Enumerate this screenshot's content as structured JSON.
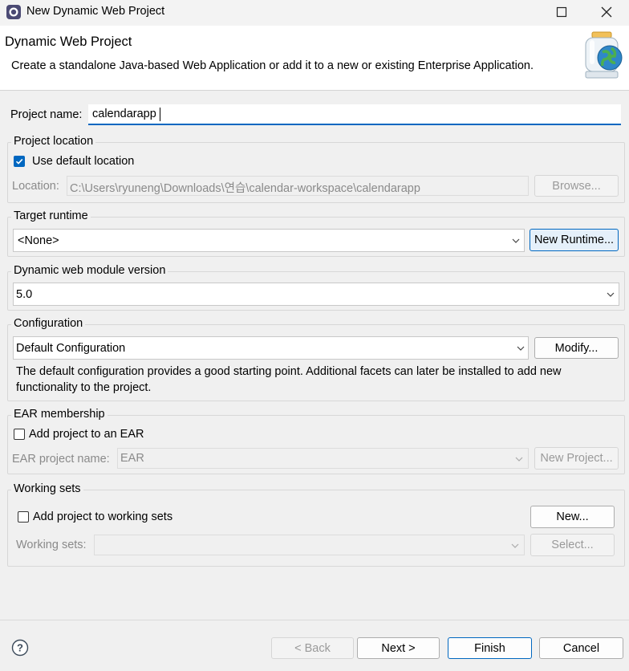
{
  "window": {
    "title": "New Dynamic Web Project",
    "icons": {
      "app": "eclipse-icon",
      "maximize": "maximize-icon",
      "close": "close-icon"
    }
  },
  "banner": {
    "title": "Dynamic Web Project",
    "description": "Create a standalone Java-based Web Application or add it to a new or existing Enterprise Application.",
    "image": "web-globe-jar-icon"
  },
  "project_name": {
    "label": "Project name:",
    "value": "calendarapp"
  },
  "project_location": {
    "group_label": "Project location",
    "use_default_label": "Use default location",
    "use_default_checked": true,
    "location_label": "Location:",
    "location_value": "C:\\Users\\ryuneng\\Downloads\\연습\\calendar-workspace\\calendarapp",
    "browse_label": "Browse..."
  },
  "target_runtime": {
    "group_label": "Target runtime",
    "selected": "<None>",
    "new_runtime_label": "New Runtime..."
  },
  "web_module": {
    "group_label": "Dynamic web module version",
    "selected": "5.0"
  },
  "configuration": {
    "group_label": "Configuration",
    "selected": "Default Configuration",
    "modify_label": "Modify...",
    "description_line1": "The default configuration provides a good starting point. Additional facets can later be installed to add new",
    "description_line2": "functionality to the project."
  },
  "ear": {
    "group_label": "EAR membership",
    "add_label": "Add project to an EAR",
    "add_checked": false,
    "name_label": "EAR project name:",
    "name_value": "EAR",
    "new_project_label": "New Project..."
  },
  "working_sets": {
    "group_label": "Working sets",
    "add_label": "Add project to working sets",
    "add_checked": false,
    "new_label": "New...",
    "sets_label": "Working sets:",
    "select_label": "Select..."
  },
  "footer": {
    "help_icon": "help-icon",
    "back_label": "< Back",
    "next_label": "Next >",
    "finish_label": "Finish",
    "cancel_label": "Cancel"
  },
  "colors": {
    "accent": "#0067c0",
    "focus_underline": "#0067c0"
  }
}
